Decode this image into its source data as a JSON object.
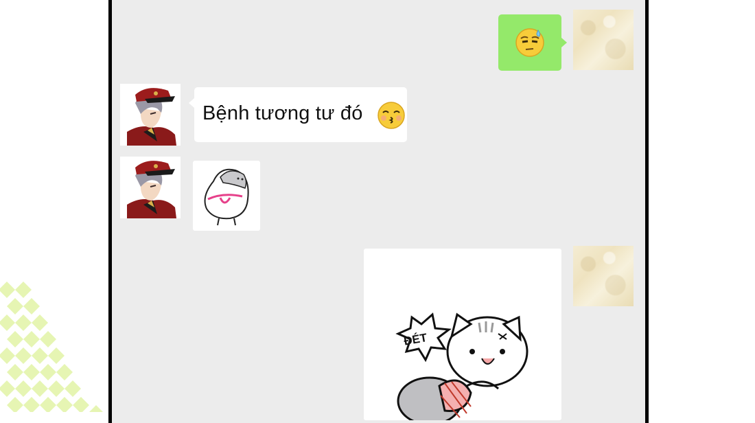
{
  "chat": {
    "messages": [
      {
        "sender": "self",
        "type": "emoji",
        "emoji": "sweat-smile-emoji"
      },
      {
        "sender": "other",
        "type": "text",
        "text": "Bệnh tương tư đó",
        "emoji": "kissing-emoji"
      },
      {
        "sender": "other",
        "type": "sticker",
        "sticker": "chick-thong-sticker"
      },
      {
        "sender": "self",
        "type": "sticker",
        "sticker": "cats-fight-sticker",
        "sticker_text": "ĐÉT"
      }
    ]
  },
  "colors": {
    "chat_background": "#ececec",
    "self_bubble": "#94e96a",
    "other_bubble": "#ffffff",
    "frame": "#000000"
  }
}
